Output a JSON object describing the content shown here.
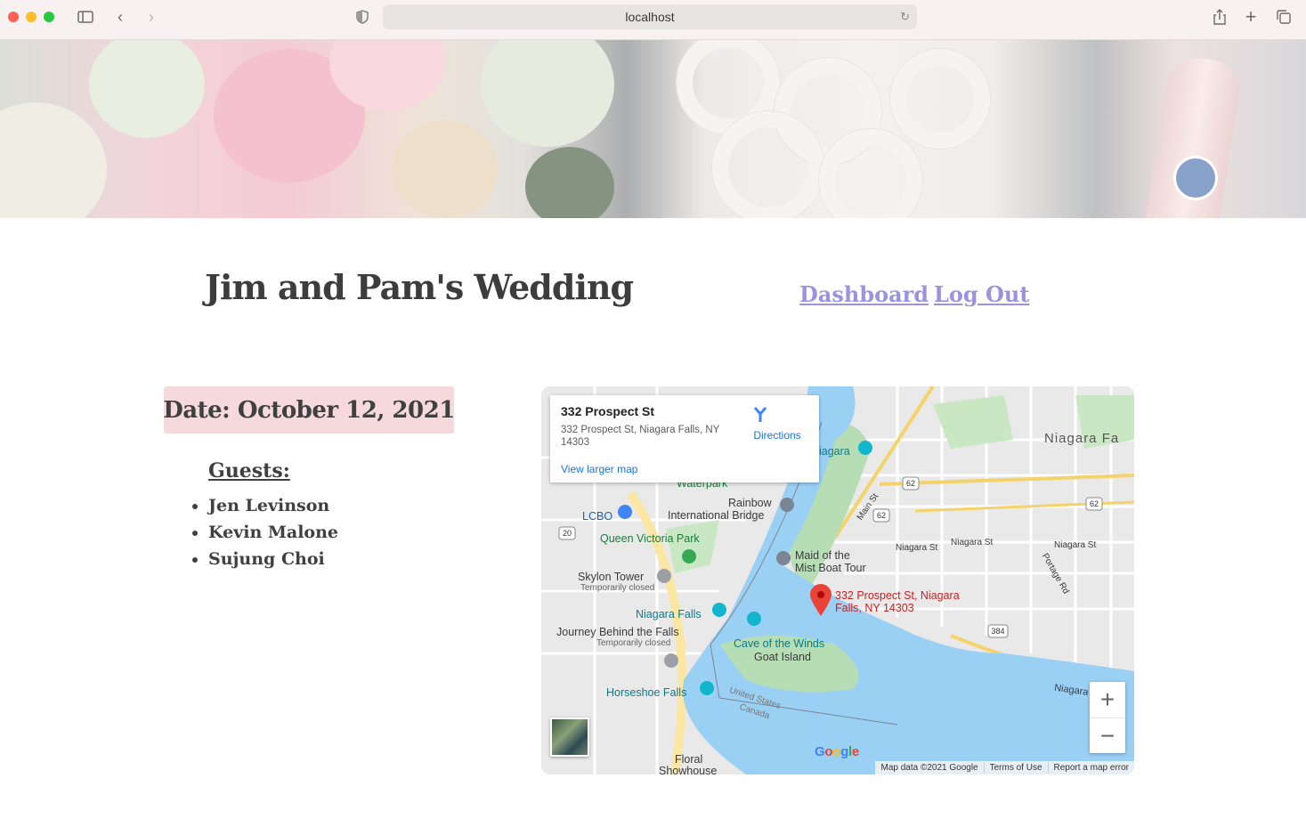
{
  "browser": {
    "url": "localhost"
  },
  "header": {
    "title": "Jim and Pam's Wedding",
    "nav": {
      "dashboard": "Dashboard",
      "logout": "Log Out"
    }
  },
  "event": {
    "date_label": "Date: October 12, 2021"
  },
  "guests": {
    "heading": "Guests:",
    "list": [
      "Jen Levinson",
      "Kevin Malone",
      "Sujung Choi"
    ]
  },
  "map": {
    "info_title": "332 Prospect St",
    "info_address": "332 Prospect St, Niagara Falls, NY 14303",
    "directions_label": "Directions",
    "view_larger": "View larger map",
    "marker_label_1": "332 Prospect St, Niagara",
    "marker_label_2": "Falls, NY 14303",
    "zoom_in": "+",
    "zoom_out": "−",
    "attribution": [
      "Map data ©2021 Google",
      "Terms of Use",
      "Report a map error"
    ],
    "labels": {
      "niagara_fa": "Niagara Fa",
      "niagara": "iagara",
      "waterpark": "Waterpark",
      "rainbow": "Rainbow",
      "intl_bridge": "International Bridge",
      "lcbo": "LCBO",
      "queen_victoria": "Queen Victoria Park",
      "maid_1": "Maid of the",
      "maid_2": "Mist Boat Tour",
      "skylon": "Skylon Tower",
      "temp_closed_1": "Temporarily closed",
      "niagara_falls": "Niagara Falls",
      "journey": "Journey Behind the Falls",
      "temp_closed_2": "Temporarily closed",
      "cave": "Cave of the Winds",
      "goat": "Goat Island",
      "horseshoe": "Horseshoe Falls",
      "us_1": "United States",
      "us_2": "Canada",
      "floral_1": "Floral",
      "floral_2": "Showhouse",
      "main_st": "Main St",
      "niagara_st_1": "Niagara St",
      "niagara_st_2": "Niagara St",
      "niagara_st_3": "Niagara St",
      "portage": "Portage Rd",
      "niagara_p": "Niagara P",
      "r62a": "62",
      "r62b": "62",
      "r62c": "62",
      "r20": "20",
      "r384": "384",
      "google": "Google"
    }
  }
}
